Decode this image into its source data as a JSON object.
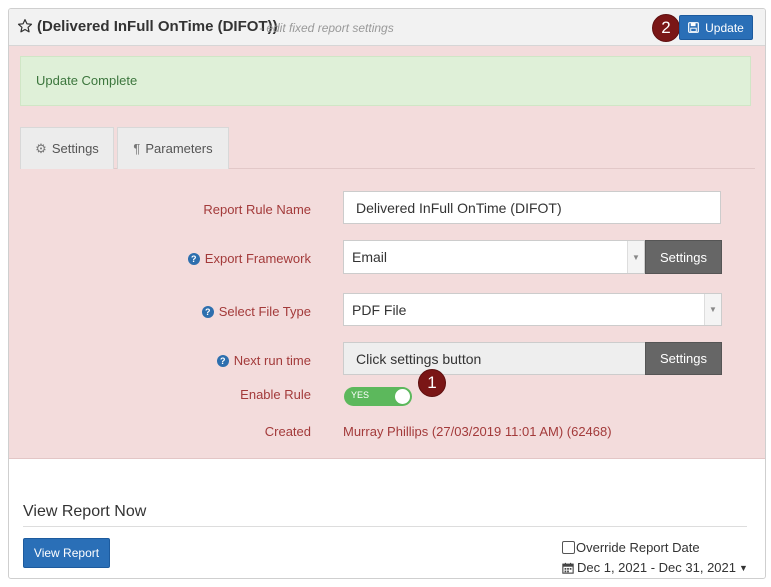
{
  "header": {
    "title": "(Delivered InFull OnTime (DIFOT))",
    "subtitle": "- edit fixed report settings",
    "update_label": "Update",
    "star_icon": "star-outline-icon",
    "save_icon": "floppy-disk-icon"
  },
  "badges": {
    "first": "1",
    "second": "2"
  },
  "alert": {
    "text": "Update Complete"
  },
  "tabs": [
    {
      "label": "Settings",
      "icon": "gear-icon"
    },
    {
      "label": "Parameters",
      "icon": "pilcrow-icon"
    }
  ],
  "form": {
    "report_rule_name": {
      "label": "Report Rule Name",
      "value": "Delivered InFull OnTime (DIFOT)"
    },
    "export_framework": {
      "label": "Export Framework",
      "value": "Email",
      "button": "Settings"
    },
    "file_type": {
      "label": "Select File Type",
      "value": "PDF File"
    },
    "next_run": {
      "label": "Next run time",
      "value": "Click settings button",
      "button": "Settings"
    },
    "enable_rule": {
      "label": "Enable Rule",
      "toggle_text": "YES",
      "enabled": true
    },
    "created": {
      "label": "Created",
      "value": "Murray Phillips (27/03/2019 11:01 AM) (62468)"
    }
  },
  "view_report": {
    "title": "View Report Now",
    "button": "View Report",
    "override_label": "Override Report Date",
    "override_checked": false,
    "date_range": "Dec 1, 2021 - Dec 31, 2021",
    "calendar_icon": "calendar-icon"
  },
  "colors": {
    "primary": "#2a6fb7",
    "badge": "#7a1616",
    "form_background": "#f3dcdc",
    "label_text": "#a33a3a",
    "success_background": "#dff0d8",
    "success_text": "#3c763d",
    "toggle_on": "#5cb85c"
  }
}
